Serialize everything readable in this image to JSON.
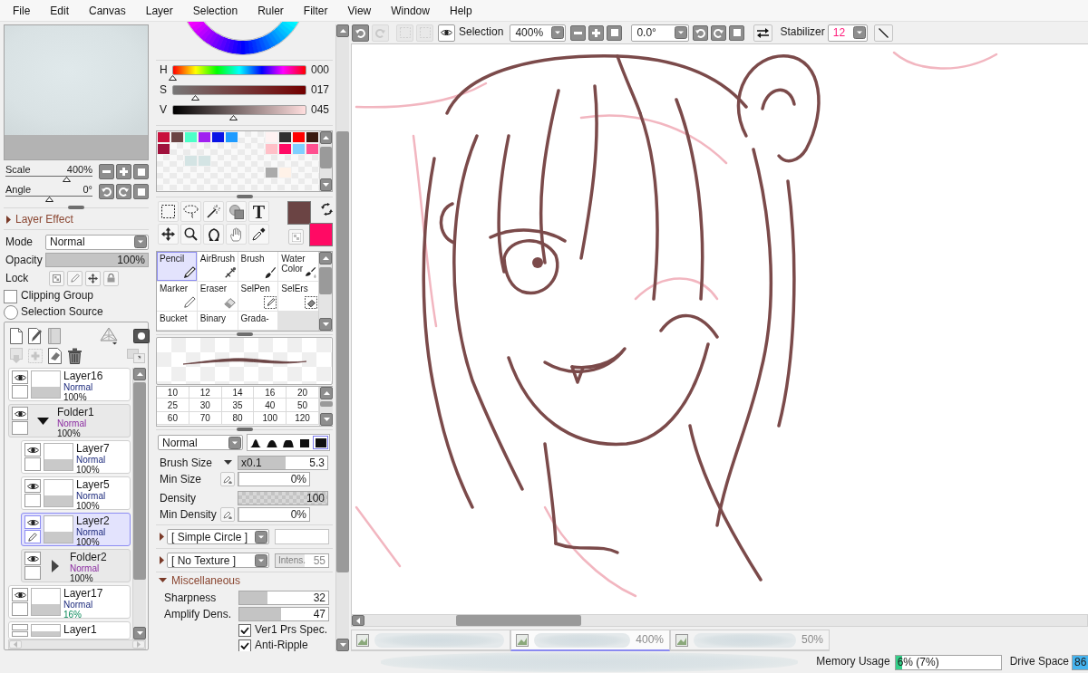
{
  "menu": [
    "File",
    "Edit",
    "Canvas",
    "Layer",
    "Selection",
    "Ruler",
    "Filter",
    "View",
    "Window",
    "Help"
  ],
  "navigator": {
    "scale": {
      "label": "Scale",
      "value": "400%",
      "level": 0.7
    },
    "angle": {
      "label": "Angle",
      "value": "0°",
      "level": 0.5
    }
  },
  "layer_effect": {
    "label": "Layer Effect",
    "expanded": false
  },
  "layer_properties": {
    "mode": {
      "label": "Mode",
      "value": "Normal"
    },
    "opacity": {
      "label": "Opacity",
      "value": "100%",
      "level": 1
    },
    "lock": {
      "label": "Lock"
    },
    "clipping_group": {
      "label": "Clipping Group",
      "checked": false
    },
    "selection_source": {
      "label": "Selection Source",
      "selected": false
    }
  },
  "layers": [
    {
      "kind": "layer",
      "name": "Layer16",
      "mode": "Normal",
      "opacity": "100%",
      "visible": true,
      "selected": false,
      "translucent": false
    },
    {
      "kind": "folder",
      "name": "Folder1",
      "mode": "Normal",
      "opacity": "100%",
      "visible": true,
      "selected": false,
      "translucent": false,
      "expanded": true,
      "children": [
        {
          "kind": "layer",
          "name": "Layer7",
          "mode": "Normal",
          "opacity": "100%",
          "visible": true,
          "selected": false,
          "translucent": false
        },
        {
          "kind": "layer",
          "name": "Layer5",
          "mode": "Normal",
          "opacity": "100%",
          "visible": true,
          "selected": false,
          "translucent": false
        },
        {
          "kind": "layer",
          "name": "Layer2",
          "mode": "Normal",
          "opacity": "100%",
          "visible": true,
          "selected": true,
          "translucent": false
        },
        {
          "kind": "folder",
          "name": "Folder2",
          "mode": "Normal",
          "opacity": "100%",
          "visible": true,
          "selected": false,
          "translucent": false,
          "expanded": false
        }
      ]
    },
    {
      "kind": "layer",
      "name": "Layer17",
      "mode": "Normal",
      "opacity": "16%",
      "visible": true,
      "selected": false,
      "translucent": true
    },
    {
      "kind": "layer",
      "name": "Layer1",
      "selected": false
    }
  ],
  "color": {
    "sliders": [
      {
        "kind": "hue",
        "label": "H",
        "value": "000",
        "level": 0
      },
      {
        "kind": "saturation",
        "label": "S",
        "value": "017",
        "level": 0.17
      },
      {
        "kind": "value",
        "label": "V",
        "value": "045",
        "level": 0.45
      }
    ],
    "palette": [
      {
        "cells": [
          {
            "kind": "swatch",
            "color": "#c8103c"
          },
          {
            "kind": "swatch",
            "color": "#6b4444"
          },
          {
            "kind": "swatch",
            "color": "#4dffc8"
          },
          {
            "kind": "swatch",
            "color": "#a020f0"
          },
          {
            "kind": "swatch",
            "color": "#0a14e6"
          },
          {
            "kind": "swatch",
            "color": "#1e9bff"
          },
          {
            "kind": "empty"
          },
          {
            "kind": "empty"
          },
          {
            "kind": "swatch",
            "color": "#fff2f2"
          },
          {
            "kind": "swatch",
            "color": "#303030"
          },
          {
            "kind": "swatch",
            "color": "#ff0000"
          },
          {
            "kind": "swatch",
            "color": "#3a1a10"
          }
        ]
      },
      {
        "cells": [
          {
            "kind": "swatch",
            "color": "#a0103c"
          },
          {
            "kind": "empty"
          },
          {
            "kind": "empty"
          },
          {
            "kind": "empty"
          },
          {
            "kind": "empty"
          },
          {
            "kind": "empty"
          },
          {
            "kind": "empty"
          },
          {
            "kind": "empty"
          },
          {
            "kind": "swatch",
            "color": "#ffc0c8"
          },
          {
            "kind": "swatch",
            "color": "#ff0a64"
          },
          {
            "kind": "swatch",
            "color": "#7fcfff"
          },
          {
            "kind": "swatch",
            "color": "#ff5090"
          }
        ]
      },
      {
        "cells": [
          {
            "kind": "empty"
          },
          {
            "kind": "empty"
          },
          {
            "kind": "swatch",
            "color": "#d4e4e4"
          },
          {
            "kind": "swatch",
            "color": "#d4e4e4"
          },
          {
            "kind": "empty"
          },
          {
            "kind": "empty"
          },
          {
            "kind": "empty"
          },
          {
            "kind": "empty"
          },
          {
            "kind": "empty"
          },
          {
            "kind": "empty"
          },
          {
            "kind": "empty"
          },
          {
            "kind": "empty"
          }
        ]
      },
      {
        "cells": [
          {
            "kind": "empty"
          },
          {
            "kind": "empty"
          },
          {
            "kind": "empty"
          },
          {
            "kind": "empty"
          },
          {
            "kind": "empty"
          },
          {
            "kind": "empty"
          },
          {
            "kind": "empty"
          },
          {
            "kind": "empty"
          },
          {
            "kind": "swatch",
            "color": "#aaaaaa"
          },
          {
            "kind": "swatch",
            "color": "#fff2e8"
          },
          {
            "kind": "empty"
          },
          {
            "kind": "empty"
          }
        ]
      },
      {
        "cells": [
          {
            "kind": "empty"
          },
          {
            "kind": "empty"
          },
          {
            "kind": "empty"
          },
          {
            "kind": "empty"
          },
          {
            "kind": "empty"
          },
          {
            "kind": "empty"
          },
          {
            "kind": "empty"
          },
          {
            "kind": "empty"
          },
          {
            "kind": "empty"
          },
          {
            "kind": "empty"
          },
          {
            "kind": "empty"
          },
          {
            "kind": "empty"
          }
        ]
      }
    ],
    "primary": {
      "color": "#6b4444"
    },
    "secondary": {
      "color": "#ff0a64"
    }
  },
  "tools": {
    "text_glyph": "T"
  },
  "brush_tools": [
    {
      "label": "Pencil",
      "selected": true
    },
    {
      "label": "AirBrush",
      "selected": false
    },
    {
      "label": "Brush",
      "selected": false
    },
    {
      "label": "Water Color",
      "selected": false
    },
    {
      "label": "Marker",
      "selected": false
    },
    {
      "label": "Eraser",
      "selected": false
    },
    {
      "label": "SelPen",
      "selected": false
    },
    {
      "label": "SelErs",
      "selected": false
    },
    {
      "label": "Bucket",
      "selected": false
    },
    {
      "label": "Binary",
      "selected": false
    },
    {
      "label": "Grada-",
      "selected": false
    }
  ],
  "brush": {
    "sizes": [
      [
        "10",
        "12",
        "14",
        "16",
        "20"
      ],
      [
        "25",
        "30",
        "35",
        "40",
        "50"
      ],
      [
        "60",
        "70",
        "80",
        "100",
        "120"
      ]
    ],
    "blend_mode": "Normal",
    "tip_shapes": [
      {
        "selected": false
      },
      {
        "selected": false
      },
      {
        "selected": false
      },
      {
        "selected": false
      },
      {
        "selected": true
      }
    ],
    "settings": [
      {
        "kind": "size",
        "label": "Brush Size",
        "multiplier": "x0.1",
        "value": "5.3",
        "level": 0.53
      },
      {
        "kind": "pressure",
        "label": "Min Size",
        "value": "0%",
        "level": 0
      },
      {
        "kind": "density",
        "label": "Density",
        "value": "100",
        "level": 1
      },
      {
        "kind": "pressure",
        "label": "Min Density",
        "value": "0%",
        "level": 0
      }
    ],
    "shape_source": {
      "value": "[ Simple Circle ]",
      "expanded": false
    },
    "texture": {
      "value": "[ No Texture ]",
      "expanded": false,
      "intensity": {
        "label": "Intens.",
        "value": "55",
        "level": 0.55,
        "disabled": true
      }
    },
    "misc": {
      "label": "Miscellaneous",
      "expanded": true,
      "sliders": [
        {
          "label": "Sharpness",
          "value": "32",
          "level": 0.32
        },
        {
          "label": "Amplify Dens.",
          "value": "47",
          "level": 0.47
        }
      ],
      "checks": [
        {
          "label": "Ver1 Prs Spec.",
          "checked": true
        },
        {
          "label": "Anti-Ripple",
          "checked": true
        }
      ]
    }
  },
  "canvas_toolbar": {
    "undo": {
      "disabled": false
    },
    "redo": {
      "disabled": true
    },
    "selection_ops": [
      {
        "disabled": true
      },
      {
        "disabled": true
      }
    ],
    "selection": {
      "label": "Selection",
      "visible": true
    },
    "zoom": "400%",
    "angle": "0.0°",
    "stabilizer": {
      "label": "Stabilizer",
      "value": "12"
    }
  },
  "document_tabs": [
    {
      "selected": false
    },
    {
      "zoom": "400%",
      "selected": true
    },
    {
      "zoom": "50%",
      "selected": false
    }
  ],
  "status_bar": {
    "memory": {
      "label": "Memory Usage",
      "value": "6% (7%)",
      "level": 0.06
    },
    "drive": {
      "label": "Drive Space",
      "value": "86"
    }
  }
}
